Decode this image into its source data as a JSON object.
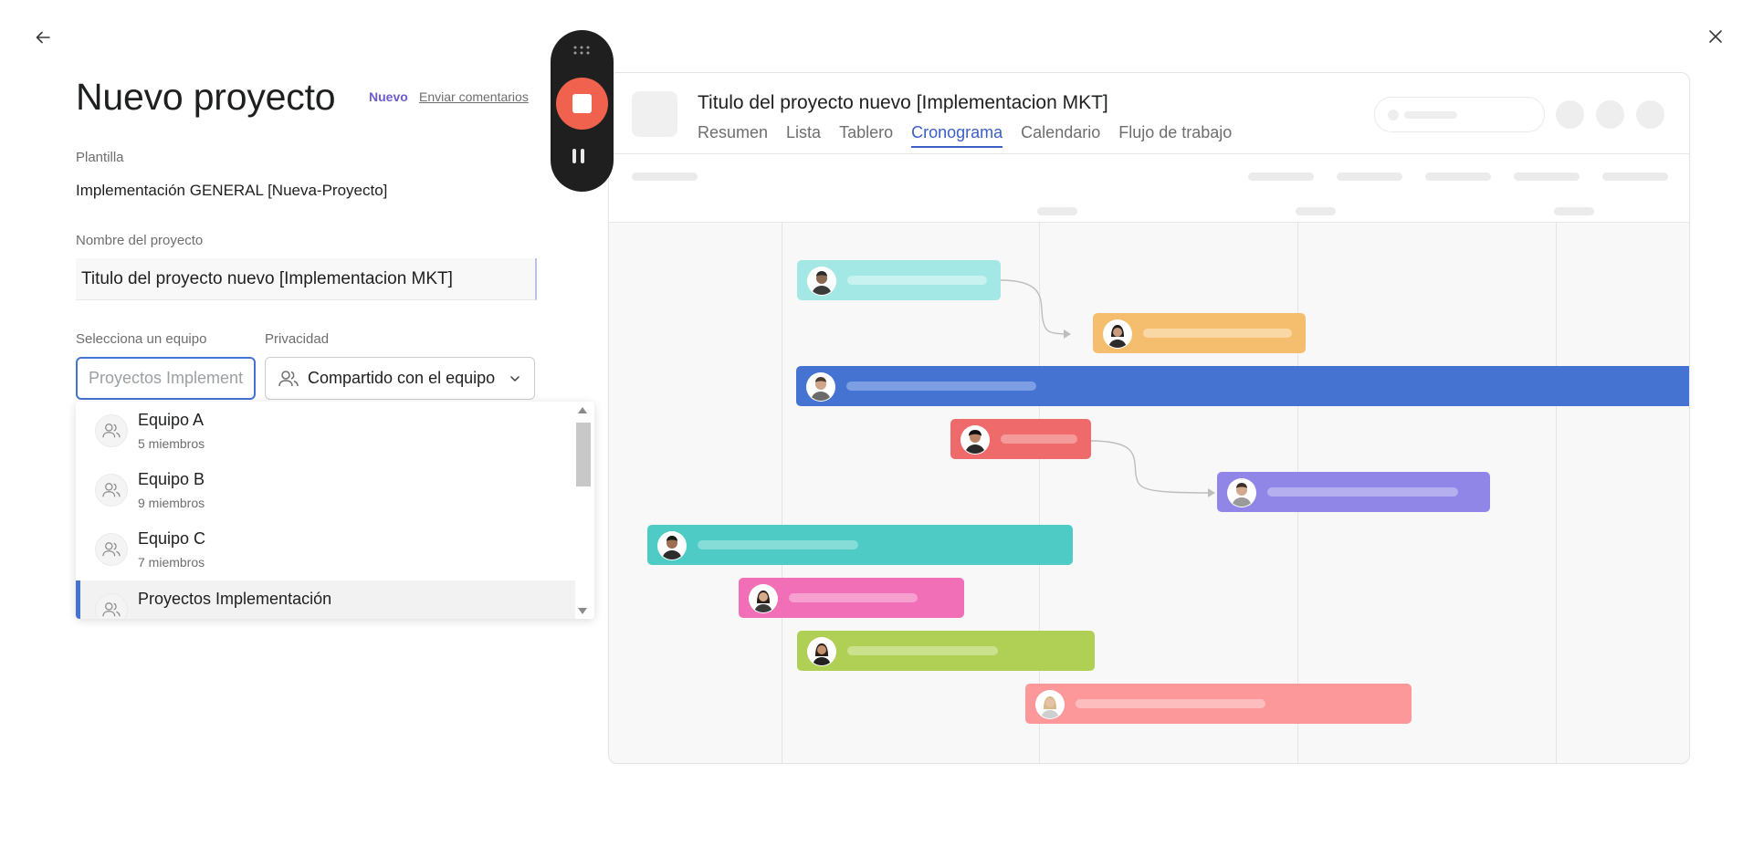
{
  "nav": {
    "back_icon": "arrow-left-icon",
    "close_icon": "close-icon"
  },
  "form": {
    "title": "Nuevo proyecto",
    "badge": "Nuevo",
    "feedback_link": "Enviar comentarios",
    "template_label": "Plantilla",
    "template_value": "Implementación GENERAL [Nueva-Proyecto]",
    "name_label": "Nombre del proyecto",
    "name_value": "Titulo del proyecto nuevo [Implementacion MKT]",
    "team_label": "Selecciona un equipo",
    "team_placeholder": "Proyectos Implementación",
    "privacy_label": "Privacidad",
    "privacy_value": "Compartido con el equipo"
  },
  "team_dropdown": {
    "items": [
      {
        "name": "Equipo A",
        "members": "5 miembros"
      },
      {
        "name": "Equipo B",
        "members": "9 miembros"
      },
      {
        "name": "Equipo C",
        "members": "7 miembros"
      },
      {
        "name": "Proyectos Implementación",
        "members": ""
      }
    ],
    "selected_index": 3
  },
  "preview": {
    "title": "Titulo del proyecto nuevo [Implementacion MKT]",
    "tabs": [
      "Resumen",
      "Lista",
      "Tablero",
      "Cronograma",
      "Calendario",
      "Flujo de trabajo"
    ],
    "active_tab": "Cronograma"
  },
  "timeline_tasks": [
    {
      "color": "#a3e8e4",
      "line": "#c8f2ef"
    },
    {
      "color": "#f5be6e",
      "line": "#f9d8a6"
    },
    {
      "color": "#4573d2",
      "line": "#7d9ee2"
    },
    {
      "color": "#ef6b6b",
      "line": "#f59a9a"
    },
    {
      "color": "#8f86e8",
      "line": "#b5afef"
    },
    {
      "color": "#4ecbc4",
      "line": "#86ddd8"
    },
    {
      "color": "#f16fb7",
      "line": "#f6a0d0"
    },
    {
      "color": "#afd055",
      "line": "#cbe18e"
    },
    {
      "color": "#fc979a",
      "line": "#fdbdbf"
    }
  ]
}
